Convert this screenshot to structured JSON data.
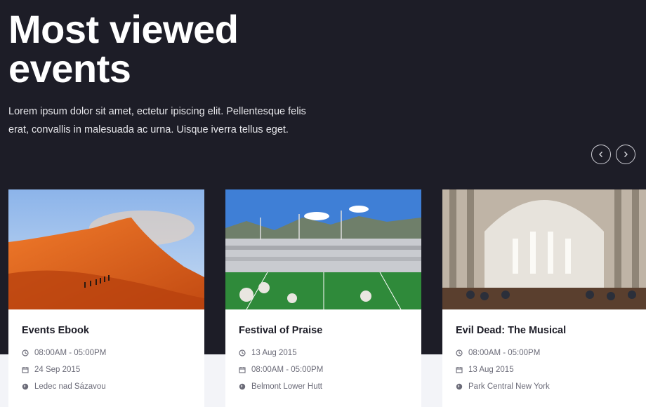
{
  "hero": {
    "title": "Most viewed events",
    "description": "Lorem ipsum dolor sit amet, ectetur ipiscing elit. Pellentesque felis erat, convallis in malesuada ac urna. Uisque iverra tellus eget."
  },
  "carousel": {
    "prev_icon": "chevron-left-icon",
    "next_icon": "chevron-right-icon"
  },
  "events": [
    {
      "name": "Events Ebook",
      "line1": "08:00AM - 05:00PM",
      "line1_icon": "clock-icon",
      "line2": "24 Sep 2015",
      "line2_icon": "calendar-icon",
      "location": "Ledec nad Sázavou",
      "image": "desert-dunes-photo"
    },
    {
      "name": "Festival of Praise",
      "line1": "13 Aug 2015",
      "line1_icon": "clock-icon",
      "line2": "08:00AM - 05:00PM",
      "line2_icon": "calendar-icon",
      "location": "Belmont Lower Hutt",
      "image": "stadium-crowd-photo"
    },
    {
      "name": "Evil Dead: The Musical",
      "line1": "08:00AM - 05:00PM",
      "line1_icon": "clock-icon",
      "line2": "13 Aug 2015",
      "line2_icon": "calendar-icon",
      "location": "Park Central New York",
      "image": "cathedral-interior-photo"
    }
  ],
  "colors": {
    "hero_bg": "#1d1d27",
    "page_bg": "#f3f4f8",
    "card_bg": "#ffffff",
    "meta_text": "#6b6b78"
  }
}
